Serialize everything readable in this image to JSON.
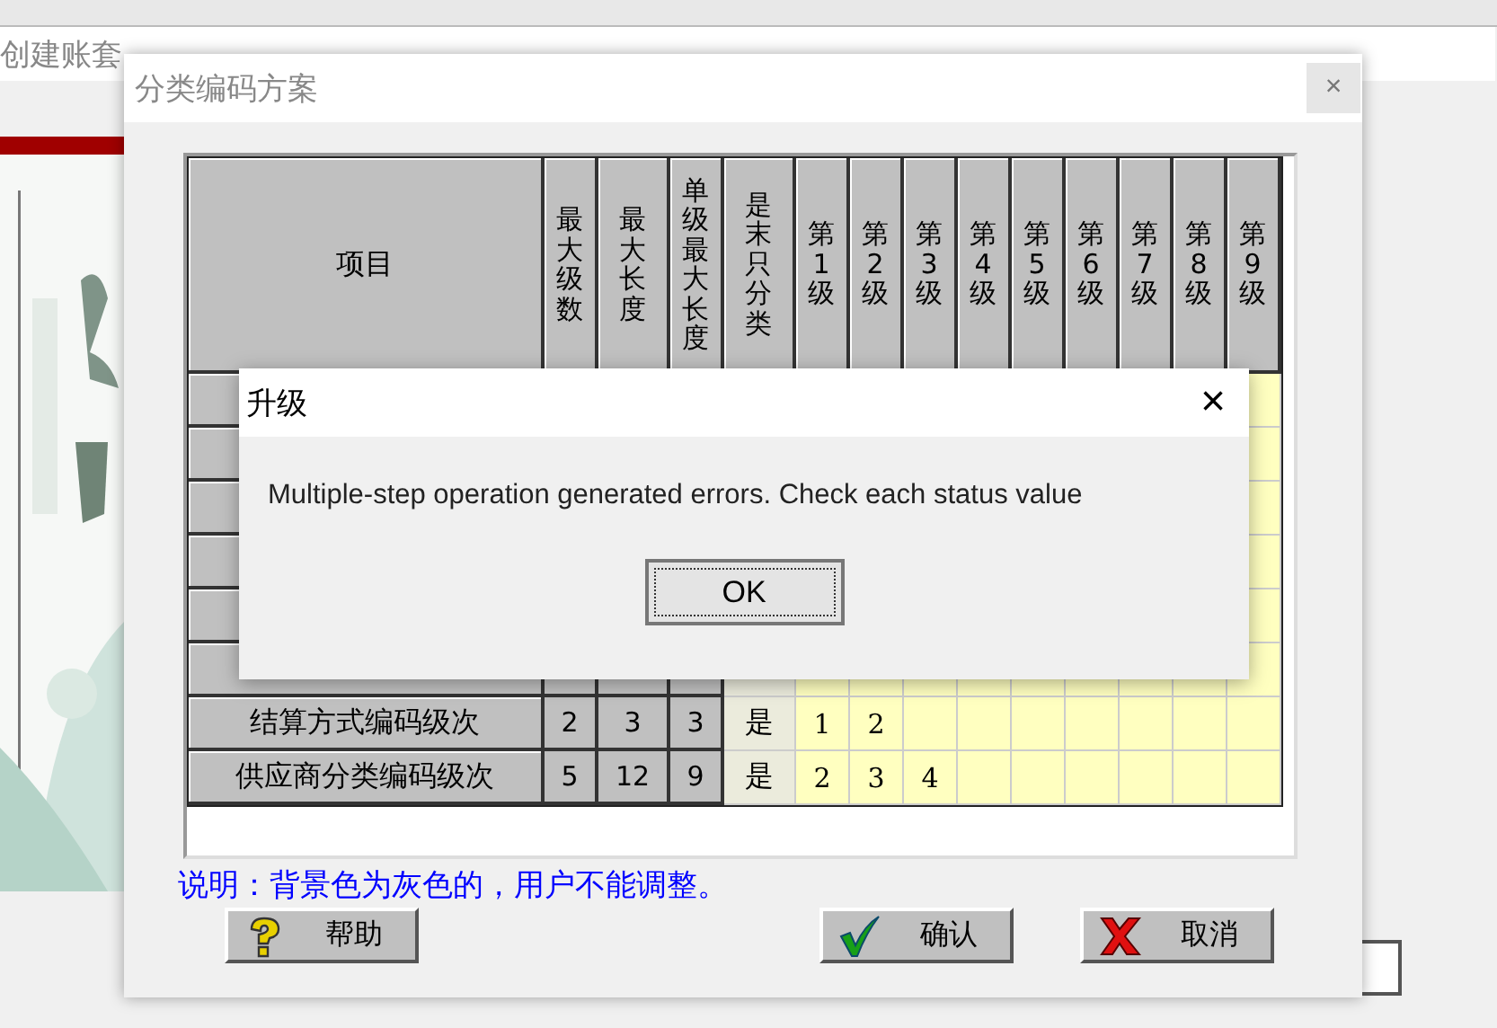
{
  "background_window": {
    "title": "创建账套"
  },
  "dialog": {
    "title": "分类编码方案",
    "close": "×",
    "columns": [
      {
        "label": "项目",
        "kind": "item"
      },
      {
        "label": "最大级数",
        "kind": "fixed"
      },
      {
        "label": "最大长度",
        "kind": "fixed"
      },
      {
        "label": "单级最大长度",
        "kind": "fixed"
      },
      {
        "label": "是末只分类",
        "kind": "flag"
      },
      {
        "label": "第1级",
        "kind": "level"
      },
      {
        "label": "第2级",
        "kind": "level"
      },
      {
        "label": "第3级",
        "kind": "level"
      },
      {
        "label": "第4级",
        "kind": "level"
      },
      {
        "label": "第5级",
        "kind": "level"
      },
      {
        "label": "第6级",
        "kind": "level"
      },
      {
        "label": "第7级",
        "kind": "level"
      },
      {
        "label": "第8级",
        "kind": "level"
      },
      {
        "label": "第9级",
        "kind": "level"
      }
    ],
    "rows": [
      {
        "cells": [
          "结算方式编码级次",
          "2",
          "3",
          "3",
          "是",
          "1",
          "2"
        ]
      },
      {
        "cells": [
          "供应商分类编码级次",
          "5",
          "12",
          "9",
          "是",
          "2",
          "3",
          "4"
        ]
      }
    ],
    "note": "说明：背景色为灰色的，用户不能调整。",
    "buttons": [
      {
        "label": "帮助",
        "kind": "help"
      },
      {
        "label": "确认",
        "kind": "ok"
      },
      {
        "label": "取消",
        "kind": "cancel"
      }
    ]
  },
  "message_box": {
    "title": "升级",
    "close": "×",
    "text": "Multiple-step operation generated errors. Check each status value",
    "button": "OK"
  }
}
